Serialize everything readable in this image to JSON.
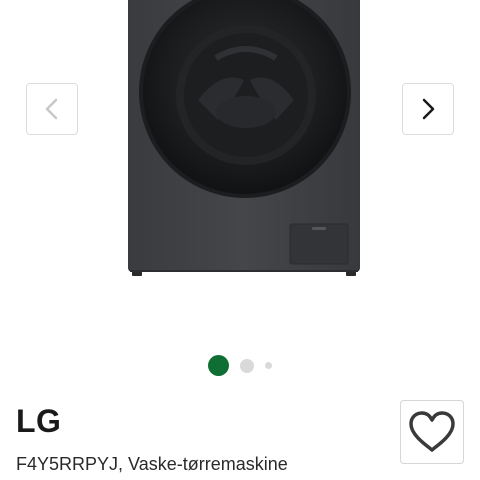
{
  "product": {
    "brand": "LG",
    "title": "F4Y5RRPYJ, Vaske-tørremaskine",
    "image_alt_icon": "washer-dryer-image"
  },
  "carousel": {
    "prev_icon": "chevron-left-icon",
    "next_icon": "chevron-right-icon",
    "active_index": 1,
    "total_dots": 3,
    "active_color": "#0f6e34",
    "inactive_color": "#d9d9d9"
  },
  "favorite": {
    "icon": "heart-outline-icon"
  }
}
